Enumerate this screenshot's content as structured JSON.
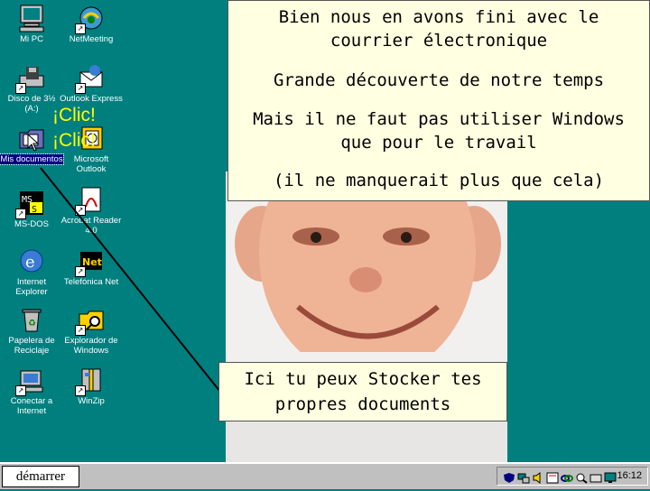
{
  "desktop": {
    "icons": [
      {
        "label": "Mi PC"
      },
      {
        "label": "NetMeeting"
      },
      {
        "label": "Disco de 3½ (A:)"
      },
      {
        "label": "Outlook Express"
      },
      {
        "label": "Mis documentos"
      },
      {
        "label": "Microsoft Outlook"
      },
      {
        "label": "MS-DOS"
      },
      {
        "label": "Acrobat Reader 4.0"
      },
      {
        "label": "Internet Explorer"
      },
      {
        "label": "Telefónica Net"
      },
      {
        "label": "Papelera de Reciclaje"
      },
      {
        "label": "Explorador de Windows"
      },
      {
        "label": "Conectar a Internet"
      },
      {
        "label": "WinZip"
      }
    ]
  },
  "overlay": {
    "clic1": "¡Clic!",
    "clic2": "¡Clic!"
  },
  "callouts": {
    "main": {
      "line1": "Bien nous en avons fini avec le",
      "line2": "courrier électronique",
      "line3": "Grande découverte de notre temps",
      "line4": "Mais il ne faut pas utiliser Windows",
      "line5": "que pour le travail",
      "line6": "(il ne manquerait plus que cela)"
    },
    "docs": {
      "line1": "Ici tu peux Stocker tes",
      "line2": "propres documents"
    }
  },
  "taskbar": {
    "start_label": "démarrer",
    "clock": "16:12"
  },
  "colors": {
    "desktop": "#007f7f",
    "callout_bg": "#ffffe1",
    "taskbar": "#c0c0c0",
    "selection": "#000080",
    "clic_text": "#ffff00"
  }
}
